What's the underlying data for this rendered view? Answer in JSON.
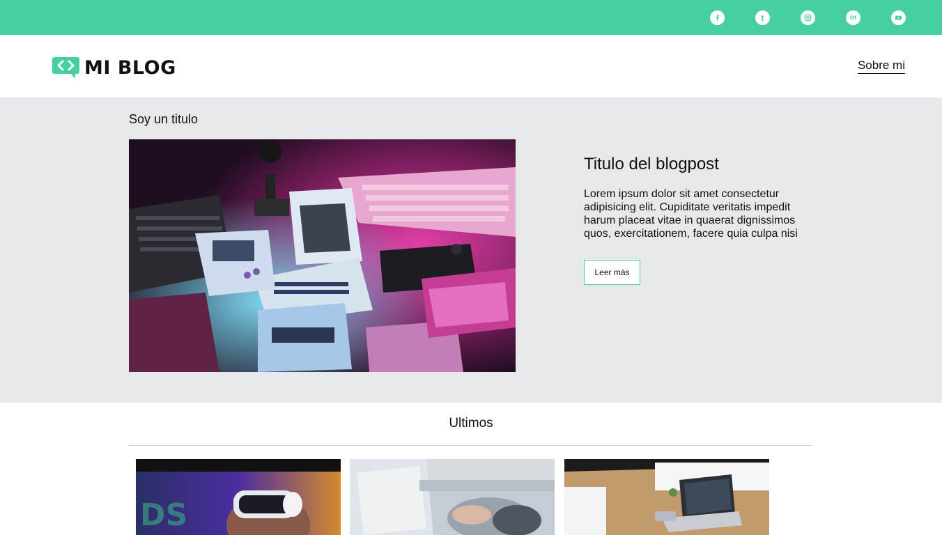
{
  "social": {
    "icons": [
      "facebook-icon",
      "tumblr-icon",
      "instagram-icon",
      "linkedin-icon",
      "youtube-icon"
    ],
    "tumblr_letter": "t",
    "linkedin_letters": "in"
  },
  "header": {
    "logo_text": "MI BLOG",
    "nav_link": "Sobre mi"
  },
  "hero": {
    "section_label": "Soy un titulo",
    "post_title": "Titulo del blogpost",
    "post_excerpt": "Lorem ipsum dolor sit amet consectetur adipisicing elit. Cupiditate veritatis impedit harum placeat vitae in quaerat dignissimos quos, exercitationem, facere quia culpa nisi",
    "read_more": "Leer más"
  },
  "latest": {
    "title": "Ultimos",
    "cards": [
      "vr-headset-photo",
      "laptop-typing-photo",
      "desk-laptop-photo"
    ]
  },
  "colors": {
    "accent": "#47cfa3",
    "hero_bg": "#e6e8ec",
    "text": "#111111"
  }
}
